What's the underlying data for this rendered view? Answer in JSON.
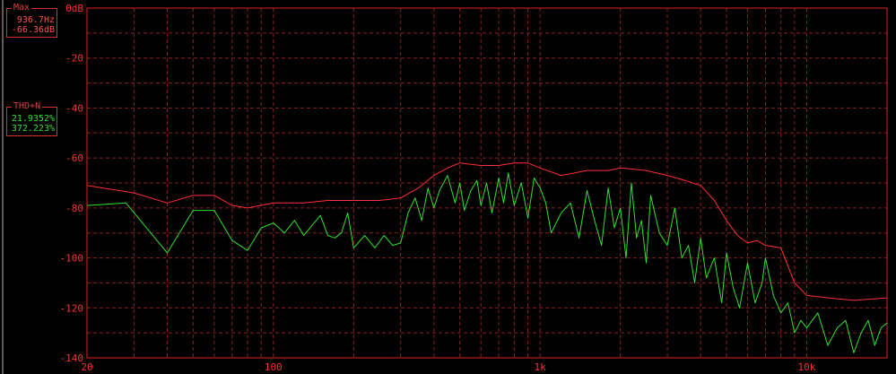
{
  "colors": {
    "background": "#000000",
    "grid": "#8a2020",
    "axis": "#e02020",
    "tick_text": "#ff3030",
    "series_max": "#ff3030",
    "series_thdn": "#30e030"
  },
  "max_box": {
    "title": "Max",
    "frequency": "936.7Hz",
    "level": "-66.36dB"
  },
  "thd_box": {
    "title": "THD+N",
    "percent_a": "21.9352%",
    "percent_b": "372.223%"
  },
  "chart_data": {
    "type": "line",
    "xscale": "log",
    "xlim": [
      20,
      20000
    ],
    "ylim": [
      -140,
      0
    ],
    "grid": true,
    "y_ticks": [
      {
        "value": 0,
        "label": "0dB"
      },
      {
        "value": -20,
        "label": "-20"
      },
      {
        "value": -40,
        "label": "-40"
      },
      {
        "value": -60,
        "label": "-60"
      },
      {
        "value": -80,
        "label": "-80"
      },
      {
        "value": -100,
        "label": "-100"
      },
      {
        "value": -120,
        "label": "-120"
      },
      {
        "value": -140,
        "label": "-140"
      }
    ],
    "x_ticks": [
      {
        "value": 20,
        "label": "20"
      },
      {
        "value": 100,
        "label": "100"
      },
      {
        "value": 1000,
        "label": "1k"
      },
      {
        "value": 10000,
        "label": "10k"
      }
    ],
    "series": [
      {
        "color": "#ff3030",
        "x": [
          20,
          30,
          40,
          50,
          60,
          70,
          80,
          100,
          130,
          160,
          200,
          250,
          300,
          350,
          400,
          450,
          500,
          600,
          700,
          800,
          900,
          1000,
          1200,
          1500,
          1800,
          2000,
          2500,
          3000,
          3500,
          4000,
          4500,
          5000,
          5500,
          6000,
          6500,
          7000,
          8000,
          9000,
          10000,
          12000,
          15000,
          20000
        ],
        "y": [
          -71,
          -74,
          -78,
          -75,
          -75,
          -79,
          -80,
          -78,
          -78,
          -77,
          -77,
          -77,
          -76,
          -72,
          -67,
          -64,
          -62,
          -63,
          -63,
          -62,
          -62,
          -64,
          -67,
          -65,
          -65,
          -64,
          -65,
          -67,
          -69,
          -71,
          -77,
          -85,
          -91,
          -94,
          -93,
          -95,
          -96,
          -110,
          -115,
          -116,
          -117,
          -116
        ]
      },
      {
        "color": "#30e030",
        "x": [
          20,
          28,
          40,
          50,
          60,
          70,
          80,
          90,
          100,
          110,
          120,
          130,
          150,
          160,
          170,
          180,
          190,
          200,
          220,
          240,
          260,
          280,
          300,
          320,
          340,
          360,
          380,
          400,
          420,
          450,
          480,
          500,
          520,
          550,
          580,
          600,
          630,
          660,
          700,
          730,
          760,
          800,
          850,
          900,
          950,
          1000,
          1050,
          1100,
          1200,
          1300,
          1400,
          1500,
          1600,
          1700,
          1800,
          1900,
          2000,
          2100,
          2200,
          2300,
          2400,
          2500,
          2600,
          2800,
          3000,
          3200,
          3400,
          3600,
          3800,
          4000,
          4200,
          4500,
          4800,
          5000,
          5300,
          5600,
          6000,
          6400,
          6800,
          7000,
          7500,
          8000,
          8500,
          9000,
          9500,
          10000,
          11000,
          12000,
          13000,
          14000,
          15000,
          16000,
          17000,
          18000,
          19000,
          20000
        ],
        "y": [
          -79,
          -78,
          -98,
          -81,
          -81,
          -93,
          -97,
          -88,
          -86,
          -90,
          -85,
          -91,
          -83,
          -91,
          -92,
          -90,
          -82,
          -96,
          -91,
          -96,
          -91,
          -95,
          -94,
          -82,
          -76,
          -85,
          -72,
          -80,
          -73,
          -67,
          -78,
          -70,
          -81,
          -73,
          -69,
          -79,
          -70,
          -82,
          -68,
          -78,
          -66,
          -79,
          -70,
          -84,
          -68,
          -72,
          -78,
          -90,
          -82,
          -78,
          -92,
          -73,
          -85,
          -95,
          -72,
          -88,
          -80,
          -100,
          -70,
          -92,
          -85,
          -102,
          -75,
          -90,
          -95,
          -80,
          -100,
          -95,
          -110,
          -92,
          -108,
          -100,
          -118,
          -98,
          -112,
          -120,
          -102,
          -118,
          -110,
          -100,
          -115,
          -122,
          -118,
          -130,
          -125,
          -128,
          -122,
          -135,
          -128,
          -125,
          -138,
          -130,
          -125,
          -135,
          -128,
          -126
        ]
      }
    ]
  }
}
